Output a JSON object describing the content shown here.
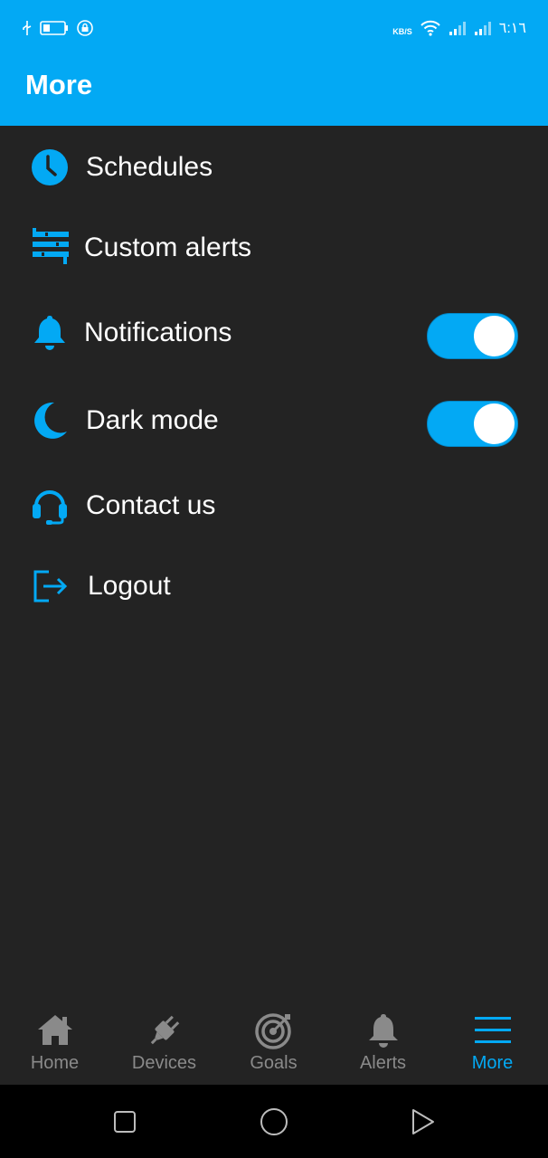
{
  "status_bar": {
    "net_speed": "KB/S",
    "time": "٦:١٦"
  },
  "header": {
    "title": "More"
  },
  "menu": [
    {
      "label": "Schedules",
      "icon": "clock-icon"
    },
    {
      "label": "Custom alerts",
      "icon": "sliders-icon"
    },
    {
      "label": "Notifications",
      "icon": "bell-icon",
      "toggle": true
    },
    {
      "label": "Dark mode",
      "icon": "moon-icon",
      "toggle": true
    },
    {
      "label": "Contact us",
      "icon": "headset-icon"
    },
    {
      "label": "Logout",
      "icon": "logout-icon"
    }
  ],
  "bottom_nav": [
    {
      "label": "Home",
      "icon": "home-icon",
      "active": false
    },
    {
      "label": "Devices",
      "icon": "plug-icon",
      "active": false
    },
    {
      "label": "Goals",
      "icon": "target-icon",
      "active": false
    },
    {
      "label": "Alerts",
      "icon": "bell-icon",
      "active": false
    },
    {
      "label": "More",
      "icon": "menu-icon",
      "active": true
    }
  ],
  "colors": {
    "accent": "#03a9f4",
    "background": "#232323",
    "inactive_nav": "#8a8a8a"
  }
}
